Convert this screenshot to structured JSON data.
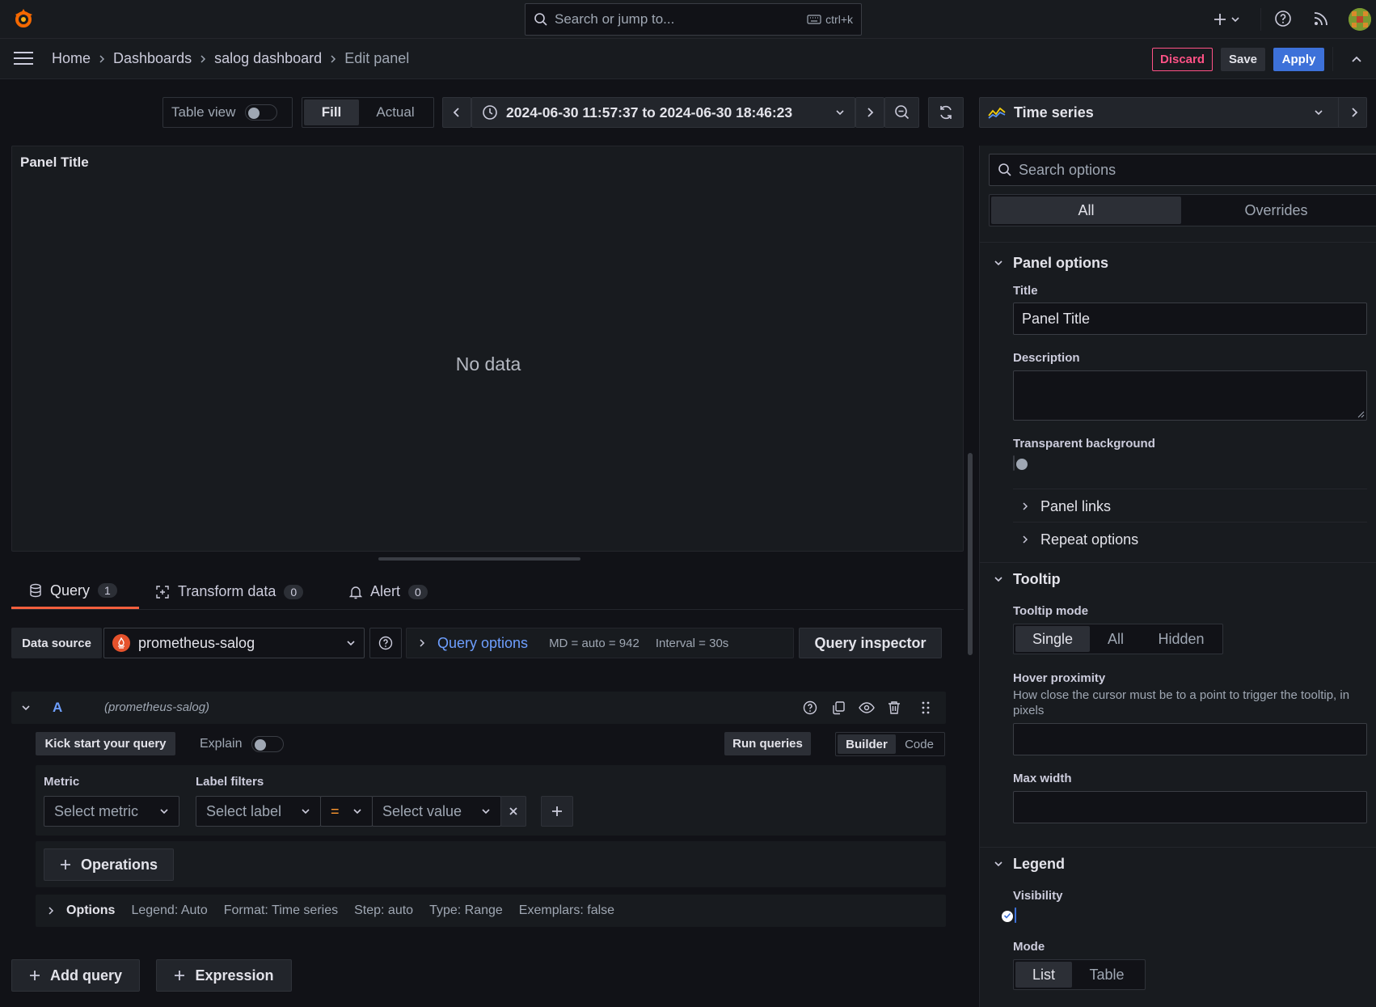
{
  "topbar": {
    "search_placeholder": "Search or jump to...",
    "shortcut": "ctrl+k"
  },
  "breadcrumb": {
    "items": [
      "Home",
      "Dashboards",
      "salog dashboard",
      "Edit panel"
    ]
  },
  "actions": {
    "discard": "Discard",
    "save": "Save",
    "apply": "Apply"
  },
  "toolbar": {
    "table_view": "Table view",
    "fill": "Fill",
    "actual": "Actual",
    "time_range": "2024-06-30 11:57:37 to 2024-06-30 18:46:23"
  },
  "panel": {
    "title": "Panel Title",
    "no_data": "No data"
  },
  "tabs": [
    {
      "label": "Query",
      "count": "1"
    },
    {
      "label": "Transform data",
      "count": "0"
    },
    {
      "label": "Alert",
      "count": "0"
    }
  ],
  "datasource": {
    "label": "Data source",
    "value": "prometheus-salog",
    "query_options": "Query options",
    "md": "MD = auto = 942",
    "interval": "Interval = 30s",
    "inspector": "Query inspector"
  },
  "query": {
    "ref": "A",
    "ds": "(prometheus-salog)",
    "kick_start": "Kick start your query",
    "explain": "Explain",
    "run": "Run queries",
    "builder": "Builder",
    "code": "Code",
    "metric_label": "Metric",
    "metric_placeholder": "Select metric",
    "label_filters": "Label filters",
    "label_placeholder": "Select label",
    "operator": "=",
    "value_placeholder": "Select value",
    "operations": "Operations",
    "options": {
      "title": "Options",
      "legend": "Legend: Auto",
      "format": "Format: Time series",
      "step": "Step: auto",
      "type": "Type: Range",
      "exemplars": "Exemplars: false"
    }
  },
  "bottom": {
    "add_query": "Add query",
    "expression": "Expression"
  },
  "viz": {
    "type": "Time series"
  },
  "options_pane": {
    "search_placeholder": "Search options",
    "tab_all": "All",
    "tab_overrides": "Overrides",
    "panel_options": {
      "title": "Panel options",
      "title_label": "Title",
      "title_value": "Panel Title",
      "description_label": "Description",
      "transparent_label": "Transparent background",
      "panel_links": "Panel links",
      "repeat_options": "Repeat options"
    },
    "tooltip": {
      "title": "Tooltip",
      "mode_label": "Tooltip mode",
      "modes": [
        "Single",
        "All",
        "Hidden"
      ],
      "hover_label": "Hover proximity",
      "hover_desc": "How close the cursor must be to a point to trigger the tooltip, in pixels",
      "max_width_label": "Max width"
    },
    "legend": {
      "title": "Legend",
      "visibility_label": "Visibility",
      "mode_label": "Mode",
      "modes": [
        "List",
        "Table"
      ]
    }
  },
  "colors": {
    "bg": "#111217",
    "panel": "#181b1f",
    "primary": "#3d71d9",
    "link": "#6e9fff",
    "danger": "#ff5286",
    "tab_active": "#f55f3e"
  }
}
